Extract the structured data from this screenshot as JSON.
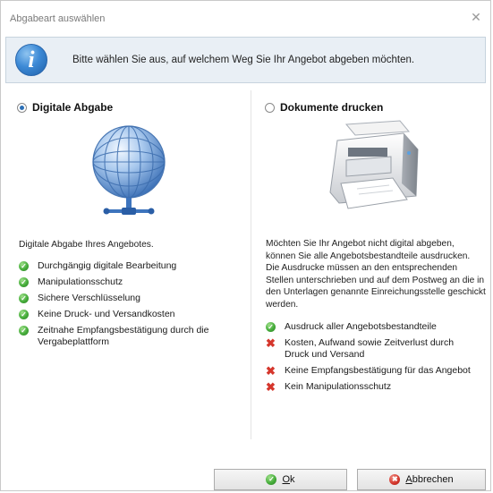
{
  "window": {
    "title": "Abgabeart auswählen",
    "close_glyph": "✕"
  },
  "info": {
    "text": "Bitte wählen Sie aus, auf welchem Weg Sie Ihr Angebot abgeben möchten.",
    "icon": "info-icon",
    "icon_glyph": "i"
  },
  "digital": {
    "label": "Digitale Abgabe",
    "selected": true,
    "image": "globe-network-icon",
    "description": "Digitale Abgabe Ihres Angebotes.",
    "pros": [
      "Durchgängig digitale Bearbeitung",
      "Manipulationsschutz",
      "Sichere Verschlüsselung",
      "Keine Druck- und Versandkosten",
      "Zeitnahe Empfangsbestätigung durch die Vergabeplattform"
    ]
  },
  "print": {
    "label": "Dokumente drucken",
    "selected": false,
    "image": "printer-icon",
    "description": "Möchten Sie Ihr Angebot nicht digital abgeben, können Sie alle Angebotsbestandteile ausdrucken. Die Ausdrucke müssen an den entsprechenden Stellen unterschrieben und auf dem Postweg an die in den Unterlagen genannte Einreichungsstelle geschickt werden.",
    "pros": [
      "Ausdruck aller Angebotsbestandteile"
    ],
    "cons": [
      "Kosten, Aufwand sowie Zeitverlust durch Druck und Versand",
      "Keine Empfangsbestätigung für das Angebot",
      "Kein Manipulationsschutz"
    ]
  },
  "buttons": {
    "ok": {
      "mnemonic": "O",
      "rest": "k"
    },
    "cancel": {
      "mnemonic": "A",
      "rest": "bbrechen"
    }
  },
  "glyphs": {
    "check": "✓",
    "cross": "✖"
  },
  "colors": {
    "check_green": "#46ad3b",
    "cross_red": "#d5362c",
    "radio_dot": "#2b6fb6",
    "infobar_bg": "#e9eff5"
  }
}
